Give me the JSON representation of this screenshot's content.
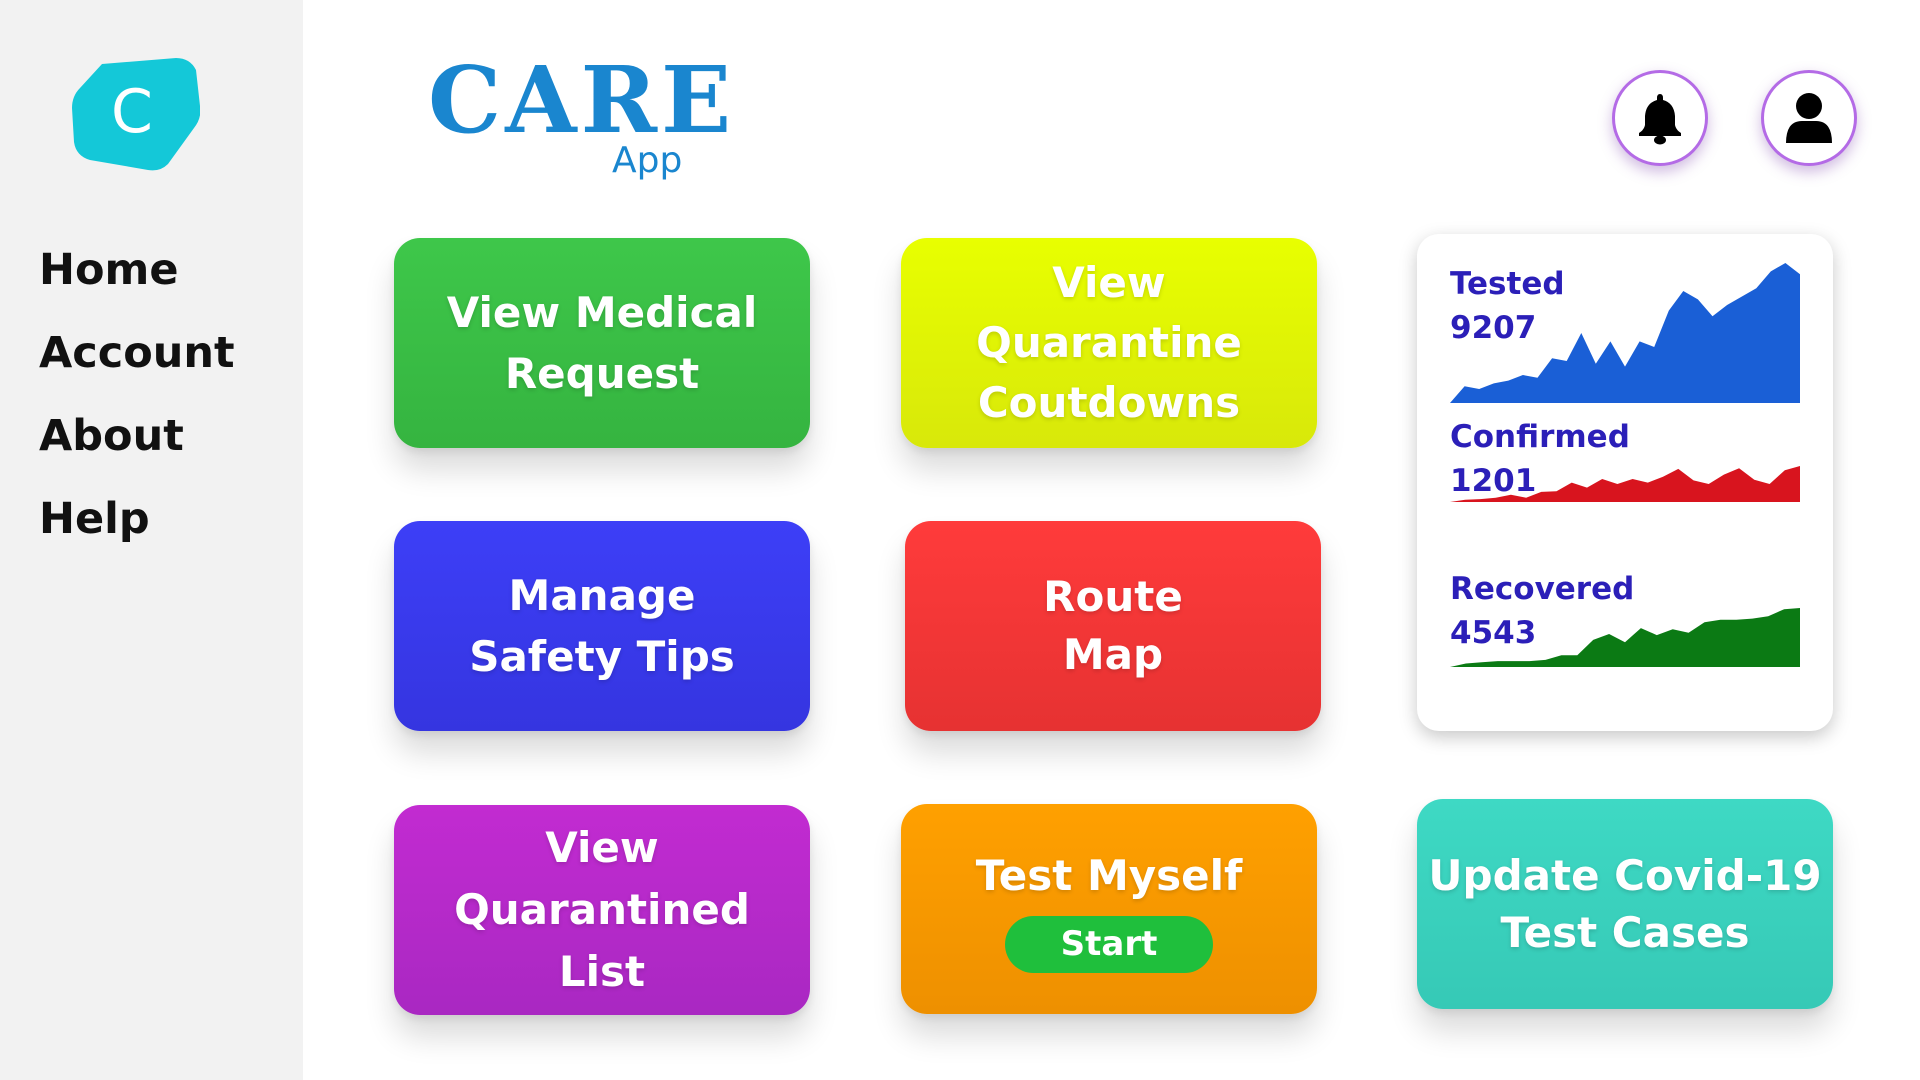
{
  "app": {
    "logo_letter": "C",
    "brand_title": "CARE",
    "brand_subtitle": "App"
  },
  "sidebar": {
    "items": [
      {
        "label": "Home"
      },
      {
        "label": "Account"
      },
      {
        "label": "About"
      },
      {
        "label": "Help"
      }
    ]
  },
  "header": {
    "notifications_icon": "bell-icon",
    "profile_icon": "user-icon"
  },
  "tiles": {
    "view_medical_request": [
      "View Medical",
      "Request"
    ],
    "view_quarantine_countdowns": [
      "View",
      "Quarantine",
      "Coutdowns"
    ],
    "manage_safety_tips": [
      "Manage",
      "Safety Tips"
    ],
    "route_map": [
      "Route",
      "Map"
    ],
    "view_quarantined_list": [
      "View",
      "Quarantined",
      "List"
    ],
    "test_myself": {
      "label": "Test Myself",
      "button": "Start"
    },
    "update_test_cases": [
      "Update Covid-19",
      "Test Cases"
    ]
  },
  "stats": [
    {
      "label": "Tested",
      "value": "9207",
      "color": "#1a5fd6",
      "trend": [
        0,
        12,
        10,
        14,
        16,
        20,
        18,
        32,
        30,
        50,
        28,
        44,
        26,
        44,
        40,
        66,
        80,
        74,
        62,
        70,
        76,
        82,
        94,
        100,
        92
      ]
    },
    {
      "label": "Confirmed",
      "value": "1201",
      "color": "#d8141e",
      "trend": [
        0,
        6,
        8,
        12,
        20,
        12,
        28,
        30,
        54,
        40,
        64,
        50,
        64,
        54,
        70,
        92,
        60,
        50,
        76,
        94,
        62,
        50,
        88,
        100
      ]
    },
    {
      "label": "Recovered",
      "value": "4543",
      "color": "#0b7a14",
      "trend": [
        0,
        6,
        8,
        10,
        10,
        10,
        12,
        20,
        20,
        46,
        56,
        42,
        66,
        54,
        64,
        58,
        76,
        80,
        80,
        82,
        86,
        98,
        100
      ]
    }
  ],
  "colors": {
    "sidebar_bg": "#f2f2f2",
    "brand": "#1a86cf",
    "logo": "#14c8d8",
    "tile_green": "#3ec74a",
    "tile_yellow": "#e8ff00",
    "tile_blue": "#3d3ff7",
    "tile_red": "#ff3b3b",
    "tile_purple": "#c22bd1",
    "tile_orange": "#ffa000",
    "tile_teal": "#3ed9c4",
    "start_button": "#1fbf3c",
    "stat_text": "#2b1fb8"
  }
}
